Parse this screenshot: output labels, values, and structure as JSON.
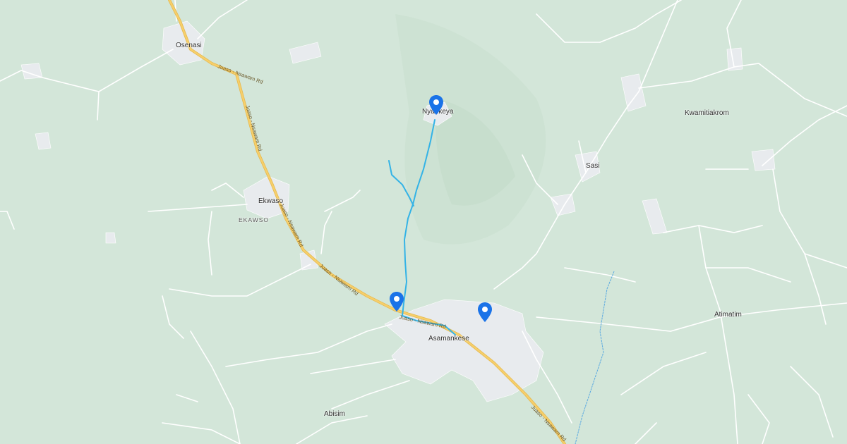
{
  "map": {
    "colors": {
      "land": "#d3e6d9",
      "road_major": "#f4c35a",
      "road_minor": "#ffffff",
      "river": "#5aa9e0",
      "route": "#34b3e6",
      "marker": "#1a73e8",
      "town": "#e8ebee"
    },
    "places": {
      "osenasi": "Osenasi",
      "ekwaso": "Ekwaso",
      "ekawso": "EKAWSO",
      "nyankeya": "Nyankeya",
      "sasi": "Sasi",
      "kwamitiakrom": "Kwamitiakrom",
      "asamankese": "Asamankese",
      "atimatim": "Atimatim",
      "abisim": "Abisim"
    },
    "road_label": "Juaso - Nsawam Rd",
    "markers": [
      "map-pin",
      "map-pin",
      "map-pin"
    ]
  }
}
